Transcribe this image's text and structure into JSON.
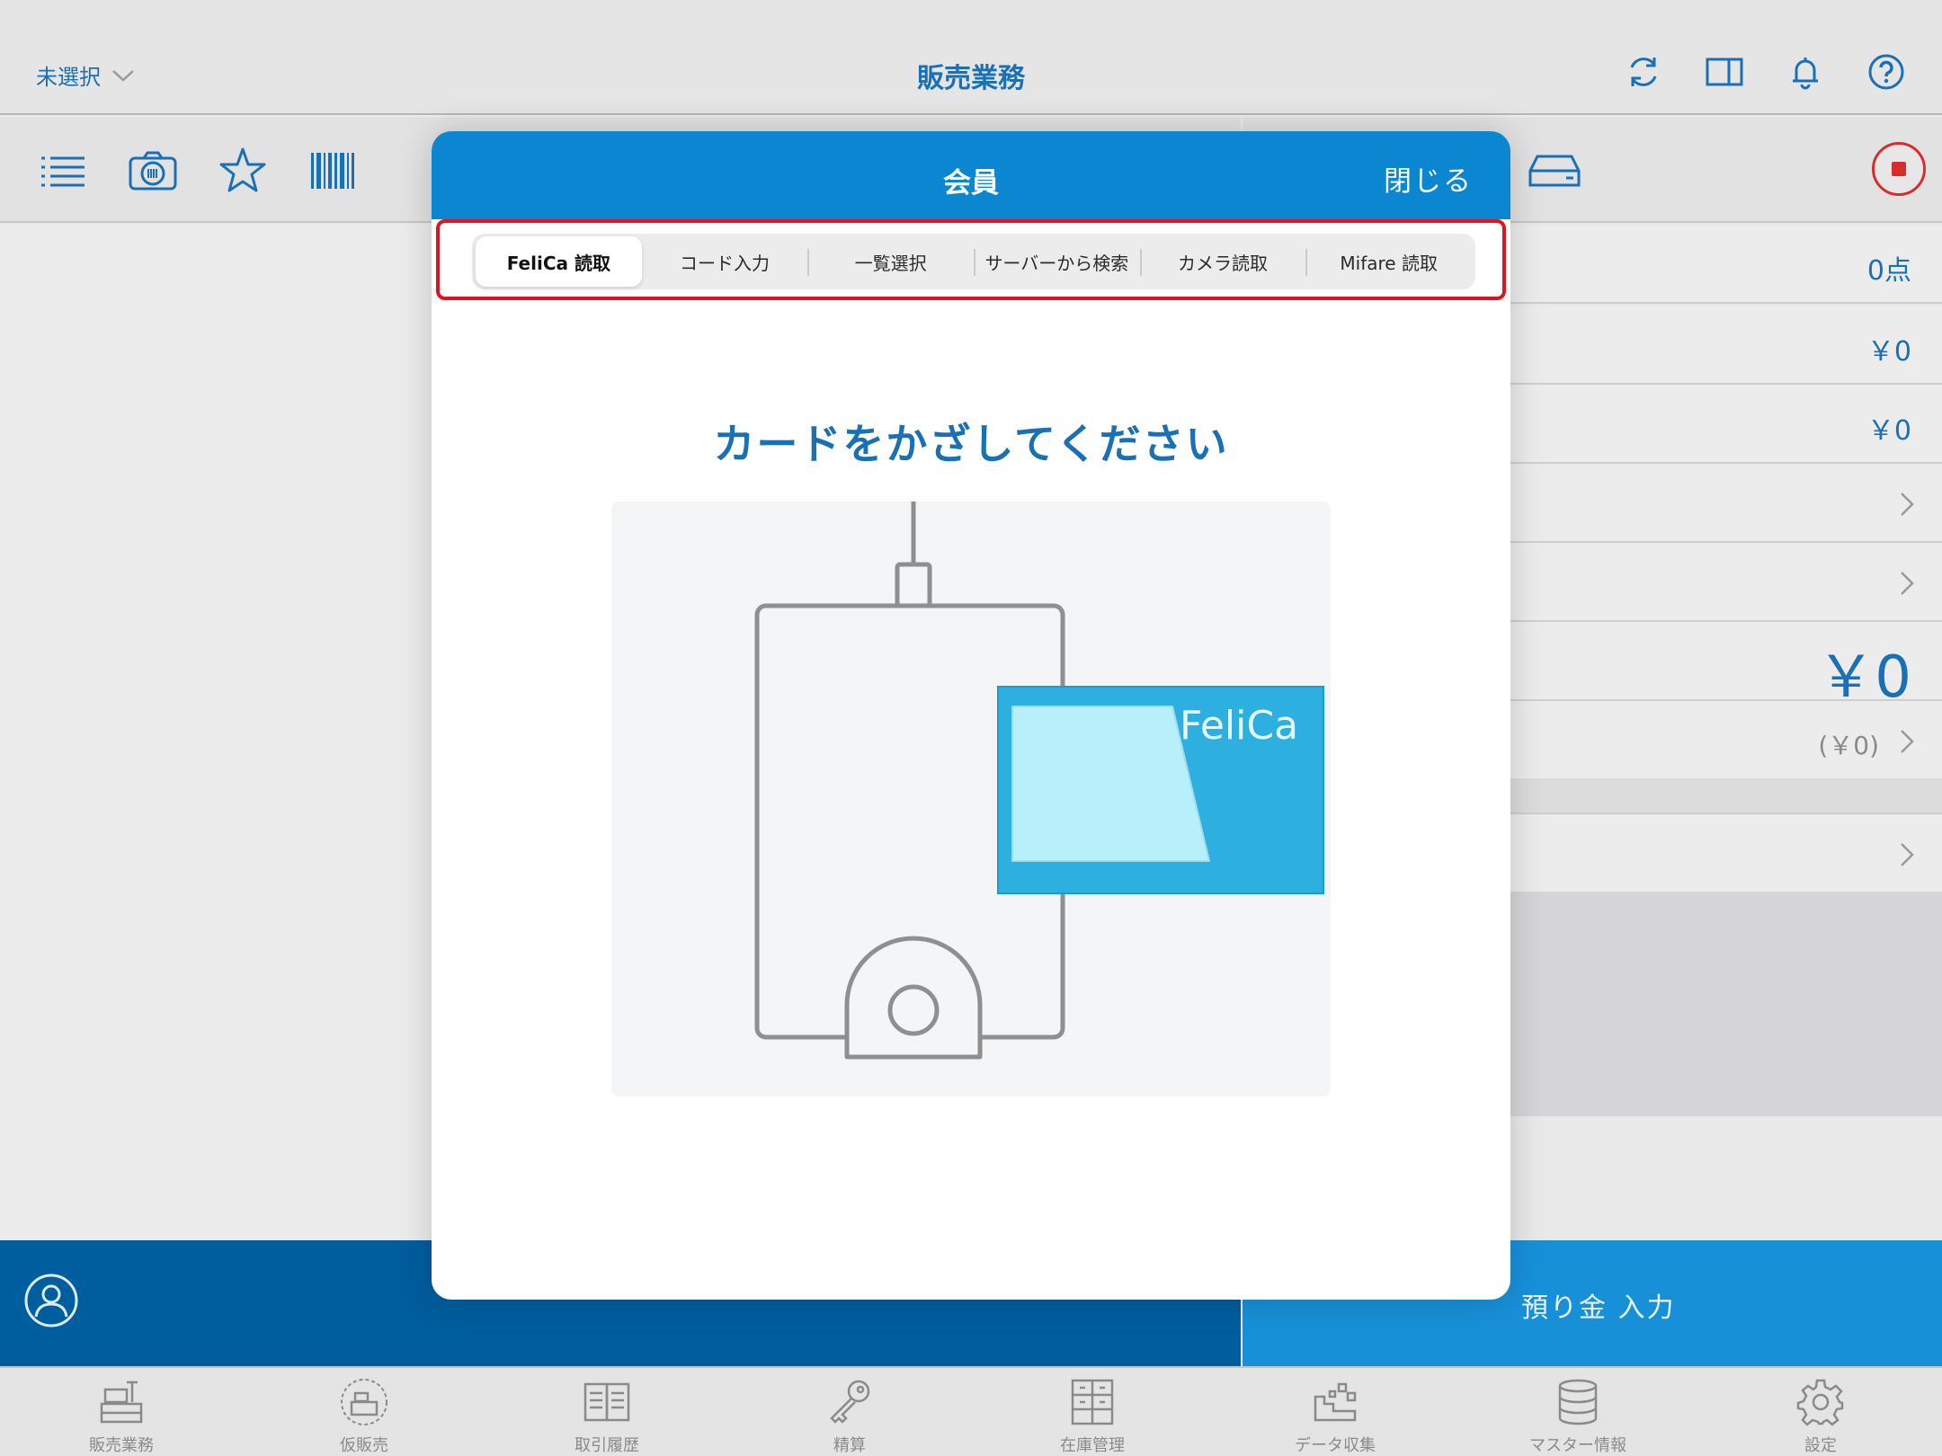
{
  "header": {
    "store_selector": "未選択",
    "title": "販売業務"
  },
  "right_summary": {
    "item_count": "0点",
    "subtotal": "￥0",
    "tax": "￥0",
    "total": "￥0",
    "change": "(￥0)"
  },
  "bottom_actions": {
    "deposit_input": "預り金 入力"
  },
  "tabbar": {
    "items": [
      {
        "label": "販売業務",
        "icon": "register-icon"
      },
      {
        "label": "仮販売",
        "icon": "temp-sale-icon"
      },
      {
        "label": "取引履歴",
        "icon": "history-book-icon"
      },
      {
        "label": "精算",
        "icon": "key-icon"
      },
      {
        "label": "在庫管理",
        "icon": "inventory-cabinet-icon"
      },
      {
        "label": "データ収集",
        "icon": "data-collection-icon"
      },
      {
        "label": "マスター情報",
        "icon": "database-icon"
      },
      {
        "label": "設定",
        "icon": "gear-icon"
      }
    ]
  },
  "modal": {
    "title": "会員",
    "close_label": "閉じる",
    "segments": [
      {
        "label": "FeliCa 読取",
        "active": true
      },
      {
        "label": "コード入力",
        "active": false
      },
      {
        "label": "一覧選択",
        "active": false
      },
      {
        "label": "サーバーから検索",
        "active": false
      },
      {
        "label": "カメラ読取",
        "active": false
      },
      {
        "label": "Mifare 読取",
        "active": false
      }
    ],
    "instruction": "カードをかざしてください",
    "card_brand": "FeliCa"
  },
  "colors": {
    "accent": "#1a70b5",
    "header_blue": "#0b86d0",
    "highlight_red": "#e0141e",
    "card_blue": "#2db0e0"
  }
}
